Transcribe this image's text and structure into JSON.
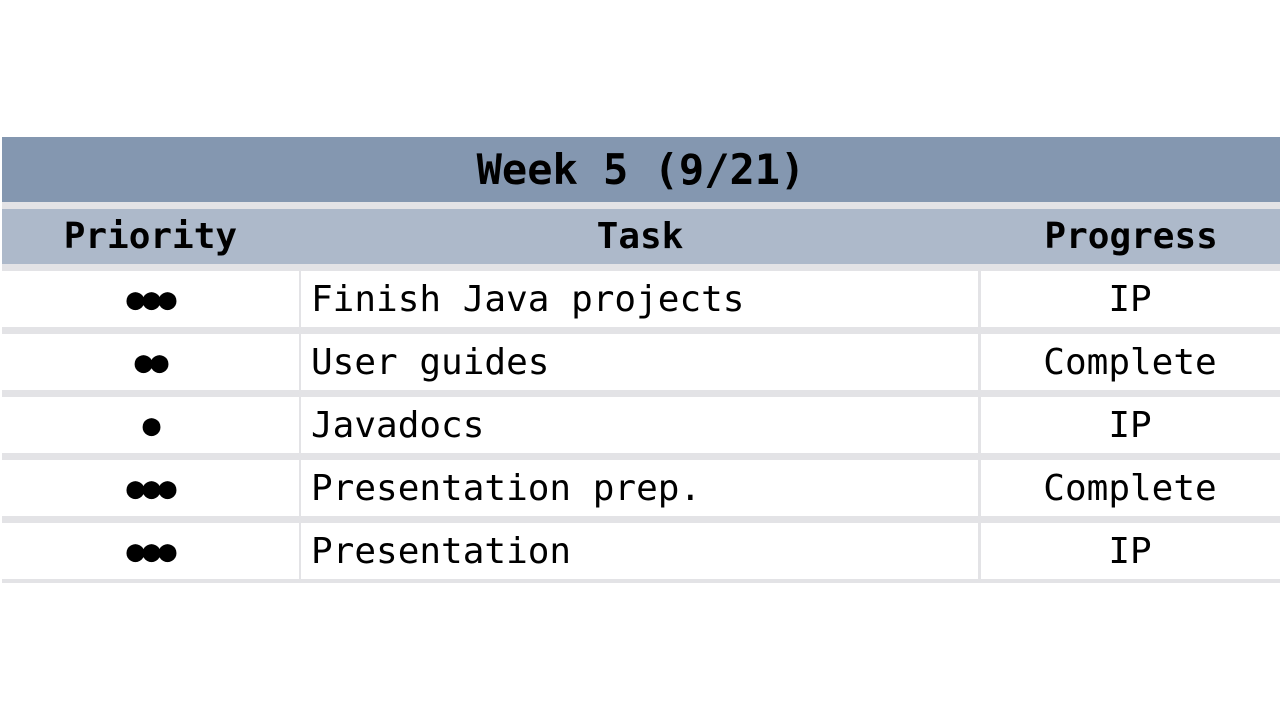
{
  "title": "Week 5 (9/21)",
  "columns": {
    "priority": "Priority",
    "task": "Task",
    "progress": "Progress"
  },
  "rows": [
    {
      "priority": "●●●",
      "task": "Finish Java projects",
      "progress": "IP"
    },
    {
      "priority": "●●",
      "task": "User guides",
      "progress": "Complete"
    },
    {
      "priority": "●",
      "task": "Javadocs",
      "progress": "IP"
    },
    {
      "priority": "●●●",
      "task": "Presentation prep.",
      "progress": "Complete"
    },
    {
      "priority": "●●●",
      "task": "Presentation",
      "progress": "IP"
    }
  ],
  "colors": {
    "title_bg": "#8497b0",
    "header_bg": "#adb9ca",
    "row_bg": "#ffffff",
    "grid": "#e3e3e6"
  }
}
